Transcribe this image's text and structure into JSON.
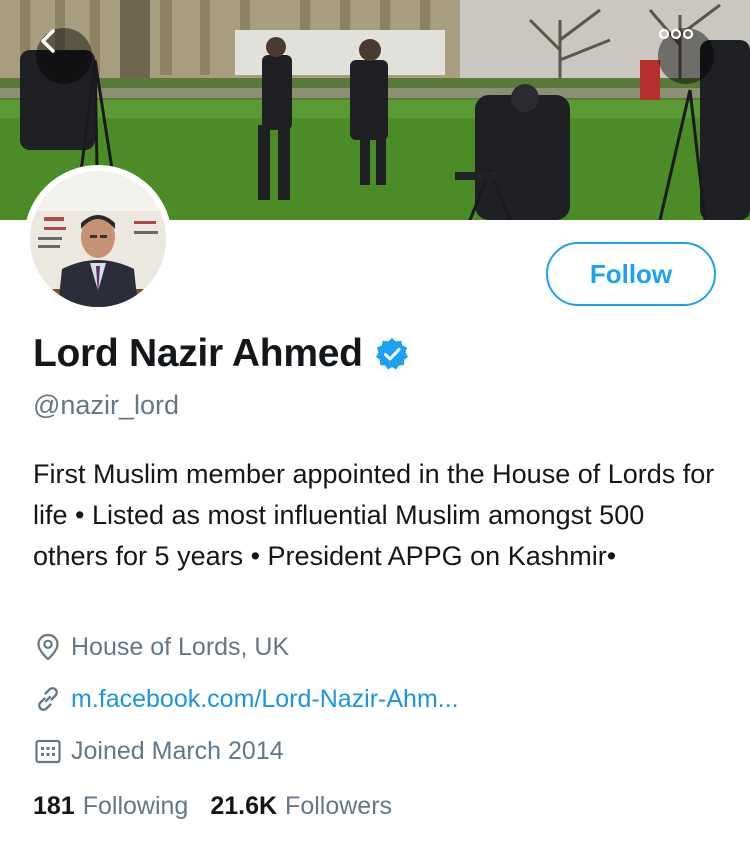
{
  "profile": {
    "display_name": "Lord Nazir Ahmed",
    "handle": "@nazir_lord",
    "bio": "First Muslim member appointed in the House of Lords for life • Listed as most influential Muslim amongst 500 others for 5 years • President APPG on Kashmir•",
    "location": "House of Lords, UK",
    "website": "m.facebook.com/Lord-Nazir-Ahm...",
    "joined": "Joined March 2014",
    "following_count": "181",
    "following_label": "Following",
    "followers_count": "21.6K",
    "followers_label": "Followers",
    "verified": true
  },
  "actions": {
    "follow_label": "Follow"
  },
  "icons": {
    "back": "chevron-left-icon",
    "more": "more-options-icon",
    "verified": "verified-badge-icon",
    "location": "location-pin-icon",
    "link": "link-icon",
    "calendar": "calendar-icon"
  },
  "colors": {
    "accent": "#1da1f2",
    "link": "#1b95e0",
    "secondary_text": "#657786",
    "primary_text": "#14171a"
  }
}
